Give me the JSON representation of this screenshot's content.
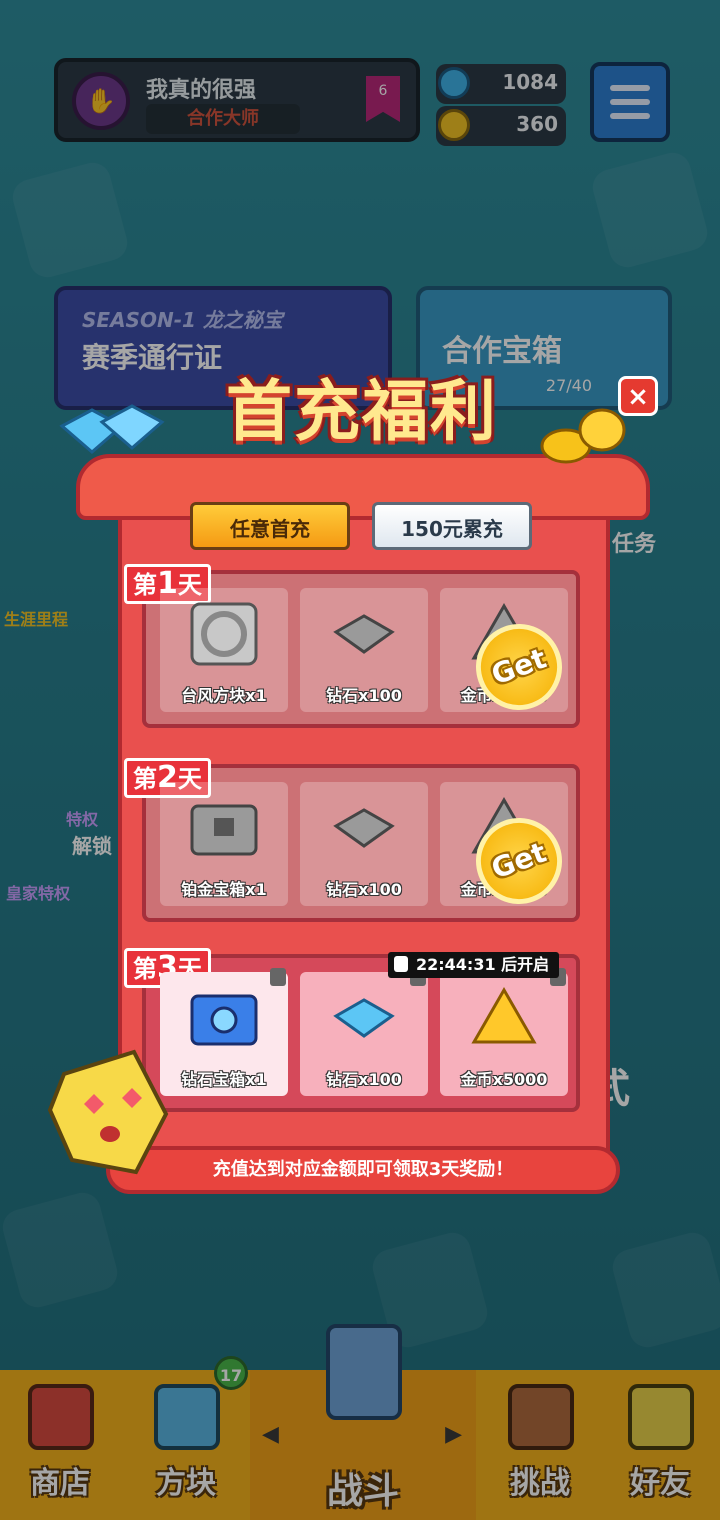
{
  "header": {
    "player_name": "我真的很强",
    "player_title": "合作大师",
    "rank": "6",
    "gems": "1084",
    "coins": "360"
  },
  "background": {
    "season_tag": "SEASON-1 龙之秘宝",
    "season_pass": "赛季通行证",
    "coop_chest": "合作宝箱",
    "coop_progress": "27/40",
    "tasks": "任务",
    "career": "生涯里程",
    "privilege": "特权",
    "unlock": "解锁",
    "royal": "皇家特权",
    "mode_partial": "式"
  },
  "popup": {
    "title": "首充福利",
    "close": "×",
    "tabs": [
      "任意首充",
      "150元累充"
    ],
    "days": [
      {
        "label_prefix": "第",
        "label_num": "1",
        "label_suffix": "天",
        "claimed": true,
        "rewards": [
          {
            "name": "台风方块x1",
            "icon": "vortex-block-icon"
          },
          {
            "name": "钻石x100",
            "icon": "diamond-icon"
          },
          {
            "name": "金币x5000",
            "icon": "coin-pile-icon"
          }
        ],
        "stamp": "Get"
      },
      {
        "label_prefix": "第",
        "label_num": "2",
        "label_suffix": "天",
        "claimed": true,
        "rewards": [
          {
            "name": "铂金宝箱x1",
            "icon": "platinum-chest-icon"
          },
          {
            "name": "钻石x100",
            "icon": "diamond-icon"
          },
          {
            "name": "金币x5000",
            "icon": "coin-pile-icon"
          }
        ],
        "stamp": "Get"
      },
      {
        "label_prefix": "第",
        "label_num": "3",
        "label_suffix": "天",
        "claimed": false,
        "rewards": [
          {
            "name": "钻石宝箱x1",
            "icon": "diamond-chest-icon"
          },
          {
            "name": "钻石x100",
            "icon": "diamond-icon"
          },
          {
            "name": "金币x5000",
            "icon": "coin-pile-icon"
          }
        ]
      }
    ],
    "timer": "22:44:31 后开启",
    "footer": "充值达到对应金额即可领取3天奖励！"
  },
  "nav": {
    "shop": "商店",
    "blocks": "方块",
    "blocks_badge": "17",
    "battle": "战斗",
    "challenge": "挑战",
    "friends": "好友"
  },
  "colors": {
    "popup_red": "#e9504e",
    "gold": "#f5b000",
    "nav_yellow": "#f4b21c"
  }
}
